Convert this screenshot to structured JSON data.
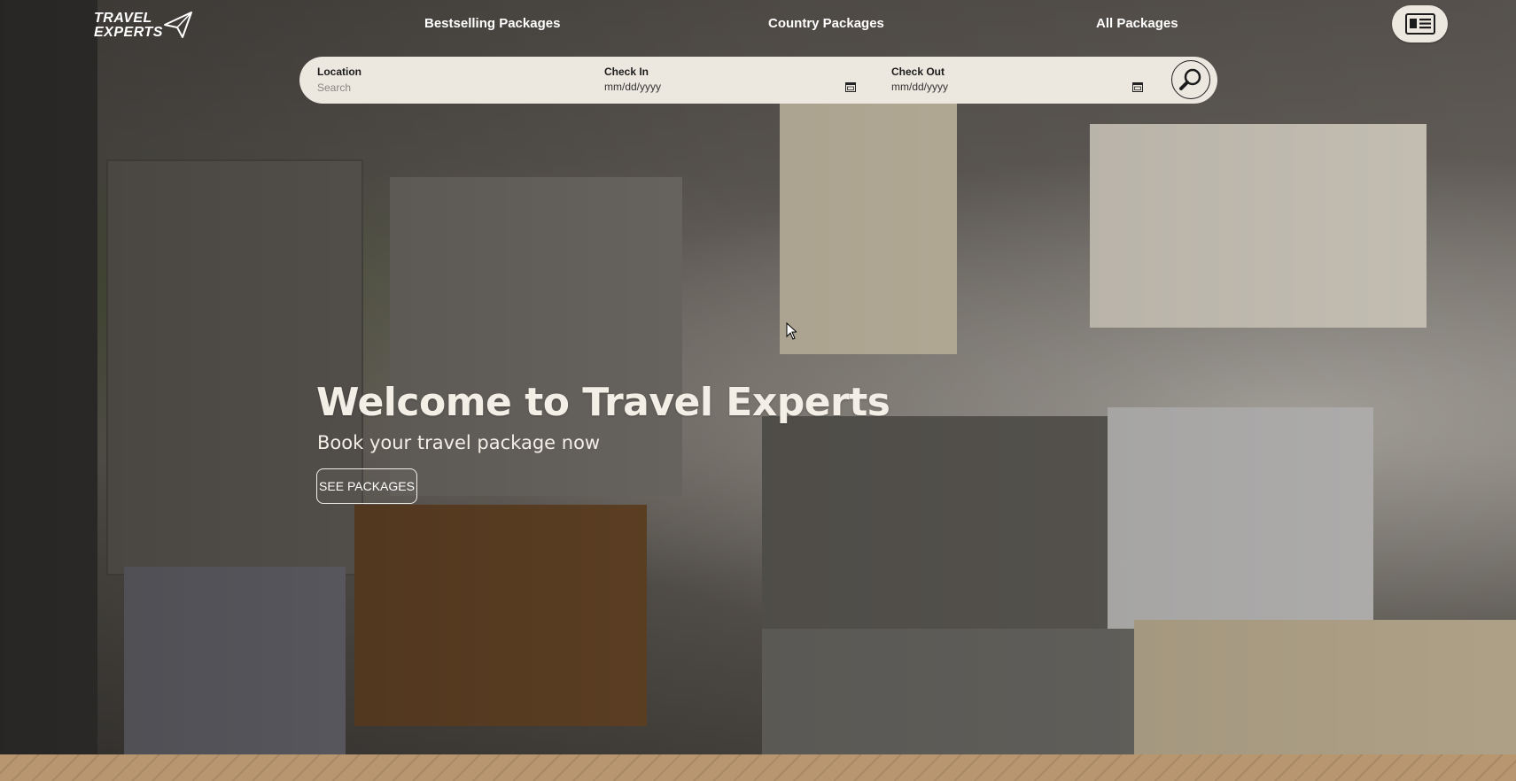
{
  "brand": {
    "logo_line1": "TRAVEL",
    "logo_line2": "EXPERTS",
    "logo_icon": "paper-plane-icon"
  },
  "nav": {
    "items": [
      {
        "label": "Bestselling Packages"
      },
      {
        "label": "Country Packages"
      },
      {
        "label": "All Packages"
      }
    ],
    "profile_icon": "id-card-icon"
  },
  "search": {
    "location_label": "Location",
    "location_placeholder": "Search",
    "checkin_label": "Check In",
    "checkin_value": "mm/dd/yyyy",
    "checkout_label": "Check Out",
    "checkout_value": "mm/dd/yyyy",
    "calendar_icon": "calendar-icon",
    "search_icon": "magnifier-icon"
  },
  "hero": {
    "title": "Welcome to Travel Experts",
    "subtitle": "Book your travel package now",
    "cta_label": "SEE PACKAGES"
  },
  "colors": {
    "searchbar_bg": "#ede8df",
    "hero_text": "#f3eee6",
    "footer_band": "#b89670"
  }
}
